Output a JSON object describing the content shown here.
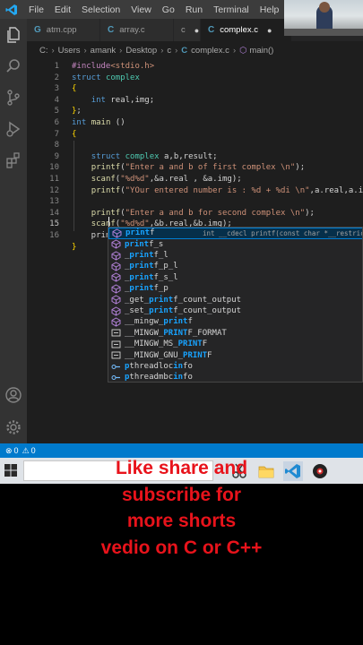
{
  "menu": [
    "File",
    "Edit",
    "Selection",
    "View",
    "Go",
    "Run",
    "Terminal",
    "Help"
  ],
  "tabs": [
    {
      "label": "atm.cpp",
      "active": false
    },
    {
      "label": "array.c",
      "active": false
    },
    {
      "label": "c",
      "active": false
    },
    {
      "label": "complex.c",
      "active": true
    }
  ],
  "breadcrumb": {
    "parts": [
      "C:",
      "Users",
      "amank",
      "Desktop",
      "c"
    ],
    "file": "complex.c",
    "symbol": "main()"
  },
  "line_numbers": [
    "1",
    "2",
    "3",
    "4",
    "5",
    "6",
    "7",
    "8",
    "9",
    "10",
    "11",
    "12",
    "13",
    "14",
    "15",
    "16"
  ],
  "code_lines": [
    "#include<stdio.h>",
    "struct complex",
    "{",
    "    int real,img;",
    "};",
    "int main ()",
    "{",
    "",
    "    struct complex a,b,result;",
    "    printf(\"Enter a and b of first complex \\n\");",
    "    scanf(\"%d%d\",&a.real , &a.img);",
    "    printf(\"YOur entered number is : %d + %di \\n\",a.real,a.img);",
    "",
    "    printf(\"Enter a and b for second complex \\n\");",
    "    scanf(\"%d%d\",&b.real,&b.img);",
    "    prin",
    "}"
  ],
  "suggestions": [
    {
      "label": "printf",
      "kind": "function",
      "detail": "int __cdecl printf(const char *__restrict"
    },
    {
      "label": "printf_s",
      "kind": "function",
      "detail": ""
    },
    {
      "label": "_printf_l",
      "kind": "function",
      "detail": ""
    },
    {
      "label": "_printf_p_l",
      "kind": "function",
      "detail": ""
    },
    {
      "label": "_printf_s_l",
      "kind": "function",
      "detail": ""
    },
    {
      "label": "_printf_p",
      "kind": "function",
      "detail": ""
    },
    {
      "label": "_get_printf_count_output",
      "kind": "function",
      "detail": ""
    },
    {
      "label": "_set_printf_count_output",
      "kind": "function",
      "detail": ""
    },
    {
      "label": "__mingw_printf",
      "kind": "function",
      "detail": ""
    },
    {
      "label": "__MINGW_PRINTF_FORMAT",
      "kind": "macro",
      "detail": ""
    },
    {
      "label": "__MINGW_MS_PRINTF",
      "kind": "macro",
      "detail": ""
    },
    {
      "label": "__MINGW_GNU_PRINTF",
      "kind": "macro",
      "detail": ""
    },
    {
      "label": "pthreadlocinfo",
      "kind": "type",
      "detail": ""
    },
    {
      "label": "pthreadmbcinfo",
      "kind": "type",
      "detail": ""
    }
  ],
  "status": {
    "errors": "0",
    "warnings": "0"
  },
  "caption": [
    "Like share and",
    "subscribe for",
    "more shorts",
    "vedio on C or C++"
  ],
  "colors": {
    "accent": "#007acc",
    "caption": "#e8131b",
    "editor_bg": "#1e1e1e"
  }
}
